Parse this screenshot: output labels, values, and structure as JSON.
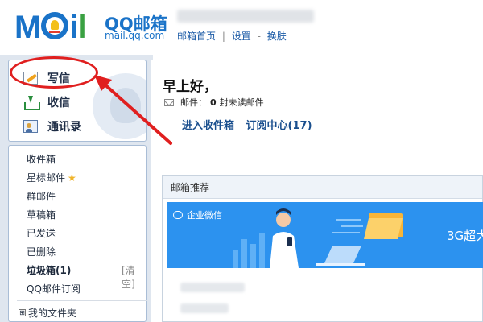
{
  "header": {
    "logo_text": "MOil",
    "brand_name": "QQ邮箱",
    "brand_url": "mail.qq.com",
    "links": [
      "邮箱首页",
      "设置",
      "换肤"
    ],
    "separators": [
      "|",
      "-"
    ]
  },
  "sidebar": {
    "primary": [
      {
        "label": "写信",
        "icon": "pencil-icon"
      },
      {
        "label": "收信",
        "icon": "inbox-icon"
      },
      {
        "label": "通讯录",
        "icon": "contacts-icon"
      }
    ],
    "folders": [
      {
        "label": "收件箱"
      },
      {
        "label": "星标邮件",
        "icon": "star-icon"
      },
      {
        "label": "群邮件"
      },
      {
        "label": "草稿箱"
      },
      {
        "label": "已发送"
      },
      {
        "label": "已删除"
      },
      {
        "label": "垃圾箱(1)",
        "action": "[清空]"
      },
      {
        "label": "QQ邮件订阅"
      }
    ],
    "my_folders": {
      "toggle": "⊞",
      "label": "我的文件夹"
    }
  },
  "main": {
    "greeting": "早上好，",
    "unread_prefix": "邮件：",
    "unread_count": "0",
    "unread_suffix": "封未读邮件",
    "links": [
      "进入收件箱",
      "订阅中心(17)"
    ],
    "recommend_title": "邮箱推荐",
    "banner_tag": "企业微信",
    "banner_text": "3G超大"
  },
  "colors": {
    "brand_blue": "#1a73c8",
    "highlight_red": "#e01f1f",
    "banner_blue": "#2c92ef",
    "sidebar_bg": "#dfe6ef"
  },
  "annotation": {
    "target": "写信"
  }
}
